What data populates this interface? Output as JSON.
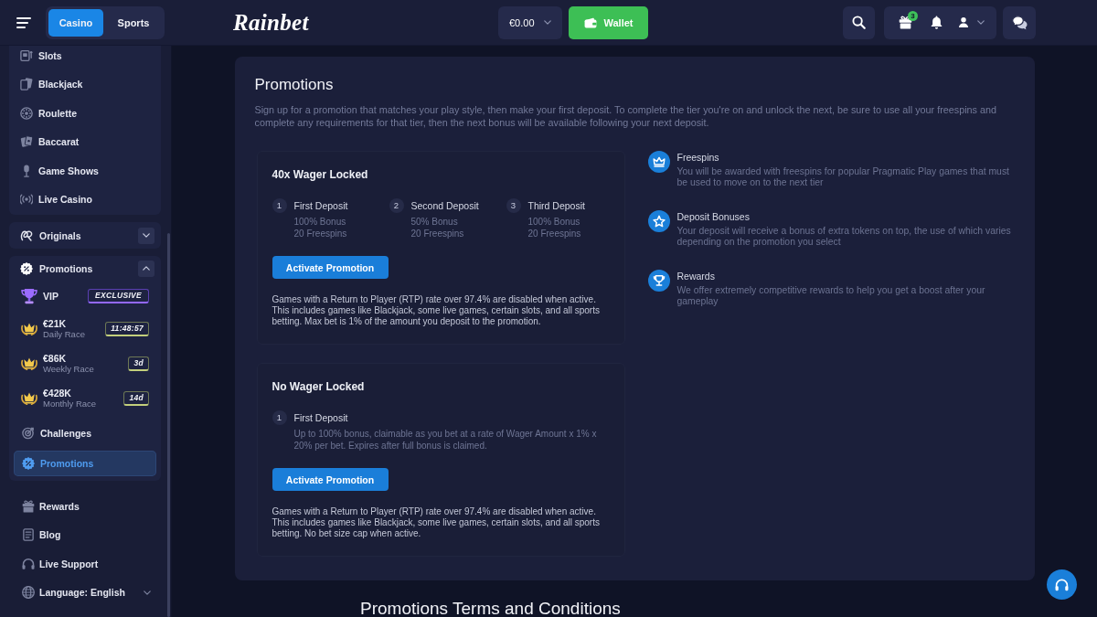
{
  "header": {
    "mode_tabs": [
      {
        "label": "Casino",
        "selected": true
      },
      {
        "label": "Sports",
        "selected": false
      }
    ],
    "logo": "Rainbet",
    "balance": "€0.00",
    "wallet_button": "Wallet",
    "gift_badge": "3"
  },
  "sidebar": {
    "games": [
      {
        "label": "Slots",
        "selected": false
      },
      {
        "label": "Blackjack",
        "selected": false
      },
      {
        "label": "Roulette",
        "selected": false
      },
      {
        "label": "Baccarat",
        "selected": false
      },
      {
        "label": "Game Shows",
        "selected": false
      },
      {
        "label": "Live Casino",
        "selected": false
      }
    ],
    "originals": {
      "label": "Originals",
      "expanded": false
    },
    "promotions": {
      "label": "Promotions",
      "expanded": true,
      "items": [
        {
          "kind": "vip",
          "label": "VIP",
          "badge": "EXCLUSIVE",
          "selected": false
        },
        {
          "kind": "race",
          "amount": "€21K",
          "label": "Daily Race",
          "timer": "11:48:57",
          "selected": false
        },
        {
          "kind": "race",
          "amount": "€86K",
          "label": "Weekly Race",
          "timer": "3d",
          "selected": false
        },
        {
          "kind": "race",
          "amount": "€428K",
          "label": "Monthly Race",
          "timer": "14d",
          "selected": false
        },
        {
          "kind": "link",
          "label": "Challenges",
          "selected": false
        },
        {
          "kind": "link",
          "label": "Promotions",
          "selected": true
        }
      ]
    },
    "links": [
      {
        "kind": "link",
        "label": "Rewards",
        "selected": false
      },
      {
        "kind": "link",
        "label": "Blog",
        "selected": false
      },
      {
        "kind": "link",
        "label": "Live Support",
        "selected": false
      },
      {
        "kind": "dropdown",
        "label": "Language: English",
        "selected": false
      }
    ]
  },
  "main": {
    "title": "Promotions",
    "intro": "Sign up for a promotion that matches your play style, then make your first deposit. To complete the tier you're on and unlock the next, be sure to use all your freespins and complete any requirements for that tier, then the next bonus will be available following your next deposit.",
    "offers": [
      {
        "title": "40x Wager Locked",
        "steps": [
          {
            "number": "1",
            "title": "First Deposit",
            "details": [
              "100% Bonus",
              "20 Freespins"
            ]
          },
          {
            "number": "2",
            "title": "Second Deposit",
            "details": [
              "50% Bonus",
              "20 Freespins"
            ]
          },
          {
            "number": "3",
            "title": "Third Deposit",
            "details": [
              "100% Bonus",
              "20 Freespins"
            ]
          }
        ],
        "button": "Activate Promotion",
        "note": "Games with a Return to Player (RTP) rate over 97.4% are disabled when active. This includes games like Blackjack, some live games, certain slots, and all sports betting. Max bet is 1% of the amount you deposit to the promotion."
      },
      {
        "title": "No Wager Locked",
        "steps": [
          {
            "number": "1",
            "title": "First Deposit",
            "details": [
              "Up to 100% bonus, claimable as you bet at a rate of Wager Amount x 1% x 20% per bet. Expires after full bonus is claimed."
            ]
          }
        ],
        "button": "Activate Promotion",
        "note": "Games with a Return to Player (RTP) rate over 97.4% are disabled when active. This includes games like Blackjack, some live games, certain slots, and all sports betting. No bet size cap when active."
      }
    ],
    "features": [
      {
        "title": "Freespins",
        "text": "You will be awarded with freespins for popular Pragmatic Play games that must be used to move on to the next tier"
      },
      {
        "title": "Deposit Bonuses",
        "text": "Your deposit will receive a bonus of extra tokens on top, the use of which varies depending on the promotion you select"
      },
      {
        "title": "Rewards",
        "text": "We offer extremely competitive rewards to help you get a boost after your gameplay"
      }
    ],
    "terms_title": "Promotions Terms and Conditions"
  }
}
